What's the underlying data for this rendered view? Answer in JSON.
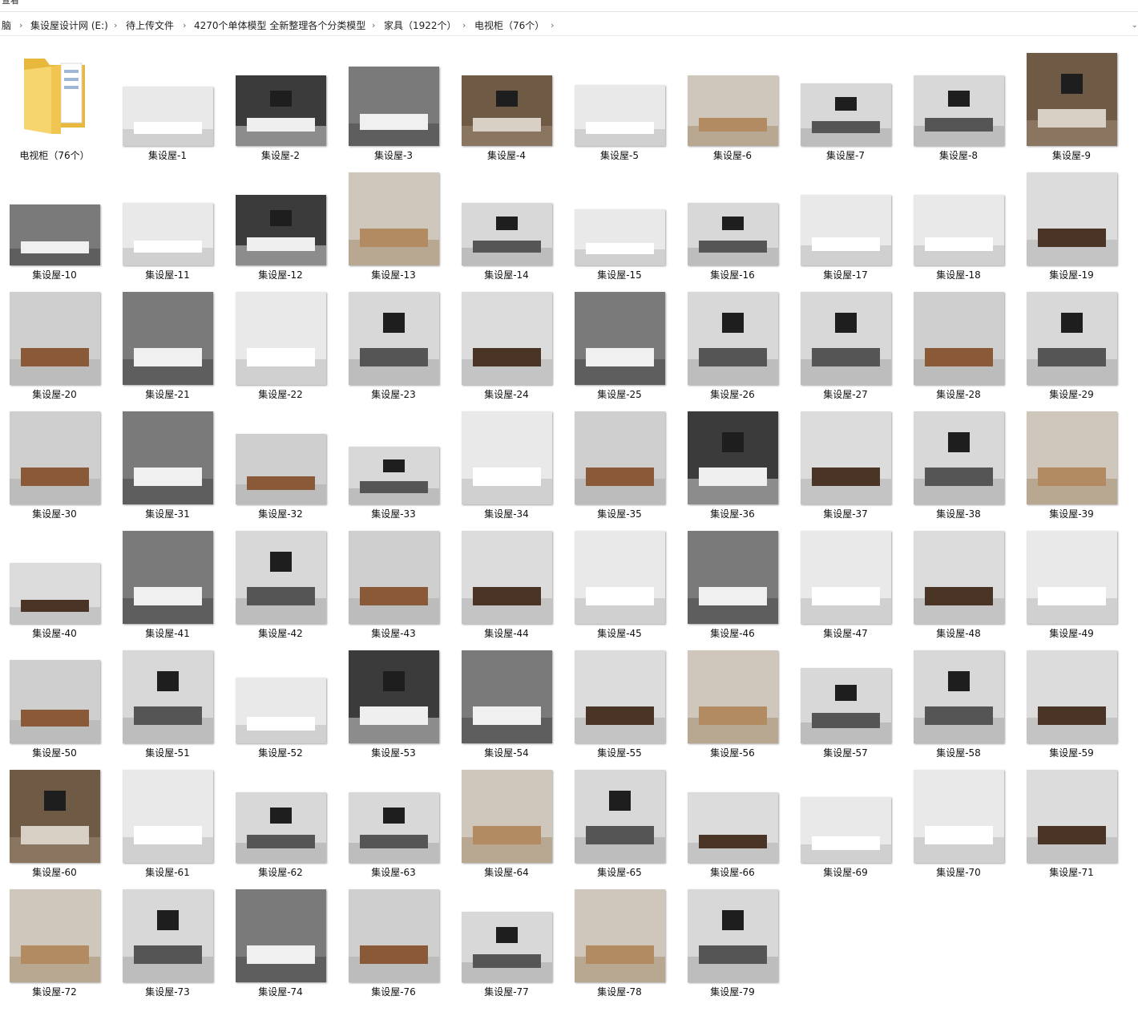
{
  "window": {
    "top_label": "查看"
  },
  "breadcrumb": {
    "items": [
      "脑",
      "集设屋设计网 (E:)",
      "待上传文件",
      "4270个单体模型 全新整理各个分类模型",
      "家具（1922个）",
      "电视柜（76个）"
    ],
    "separator": "›",
    "dropdown": "⌄"
  },
  "folder": {
    "label": "电视柜（76个）",
    "icon": "folder-icon"
  },
  "files": [
    {
      "label": "集设屋-1",
      "style": "d"
    },
    {
      "label": "集设屋-2",
      "style": "c"
    },
    {
      "label": "集设屋-3",
      "style": "b"
    },
    {
      "label": "集设屋-4",
      "style": "a"
    },
    {
      "label": "集设屋-5",
      "style": "d"
    },
    {
      "label": "集设屋-6",
      "style": "e"
    },
    {
      "label": "集设屋-7",
      "style": "f"
    },
    {
      "label": "集设屋-8",
      "style": "f"
    },
    {
      "label": "集设屋-9",
      "style": "a"
    },
    {
      "label": "集设屋-10",
      "style": "b"
    },
    {
      "label": "集设屋-11",
      "style": "d"
    },
    {
      "label": "集设屋-12",
      "style": "c"
    },
    {
      "label": "集设屋-13",
      "style": "e"
    },
    {
      "label": "集设屋-14",
      "style": "f"
    },
    {
      "label": "集设屋-15",
      "style": "d"
    },
    {
      "label": "集设屋-16",
      "style": "f"
    },
    {
      "label": "集设屋-17",
      "style": "d"
    },
    {
      "label": "集设屋-18",
      "style": "d"
    },
    {
      "label": "集设屋-19",
      "style": "g"
    },
    {
      "label": "集设屋-20",
      "style": "h"
    },
    {
      "label": "集设屋-21",
      "style": "b"
    },
    {
      "label": "集设屋-22",
      "style": "d"
    },
    {
      "label": "集设屋-23",
      "style": "f"
    },
    {
      "label": "集设屋-24",
      "style": "g"
    },
    {
      "label": "集设屋-25",
      "style": "b"
    },
    {
      "label": "集设屋-26",
      "style": "f"
    },
    {
      "label": "集设屋-27",
      "style": "f"
    },
    {
      "label": "集设屋-28",
      "style": "h"
    },
    {
      "label": "集设屋-29",
      "style": "f"
    },
    {
      "label": "集设屋-30",
      "style": "h"
    },
    {
      "label": "集设屋-31",
      "style": "b"
    },
    {
      "label": "集设屋-32",
      "style": "h"
    },
    {
      "label": "集设屋-33",
      "style": "f"
    },
    {
      "label": "集设屋-34",
      "style": "d"
    },
    {
      "label": "集设屋-35",
      "style": "h"
    },
    {
      "label": "集设屋-36",
      "style": "c"
    },
    {
      "label": "集设屋-37",
      "style": "g"
    },
    {
      "label": "集设屋-38",
      "style": "f"
    },
    {
      "label": "集设屋-39",
      "style": "e"
    },
    {
      "label": "集设屋-40",
      "style": "g"
    },
    {
      "label": "集设屋-41",
      "style": "b"
    },
    {
      "label": "集设屋-42",
      "style": "f"
    },
    {
      "label": "集设屋-43",
      "style": "h"
    },
    {
      "label": "集设屋-44",
      "style": "g"
    },
    {
      "label": "集设屋-45",
      "style": "d"
    },
    {
      "label": "集设屋-46",
      "style": "b"
    },
    {
      "label": "集设屋-47",
      "style": "d"
    },
    {
      "label": "集设屋-48",
      "style": "g"
    },
    {
      "label": "集设屋-49",
      "style": "d"
    },
    {
      "label": "集设屋-50",
      "style": "h"
    },
    {
      "label": "集设屋-51",
      "style": "f"
    },
    {
      "label": "集设屋-52",
      "style": "d"
    },
    {
      "label": "集设屋-53",
      "style": "c"
    },
    {
      "label": "集设屋-54",
      "style": "b"
    },
    {
      "label": "集设屋-55",
      "style": "g"
    },
    {
      "label": "集设屋-56",
      "style": "e"
    },
    {
      "label": "集设屋-57",
      "style": "f"
    },
    {
      "label": "集设屋-58",
      "style": "f"
    },
    {
      "label": "集设屋-59",
      "style": "g"
    },
    {
      "label": "集设屋-60",
      "style": "a"
    },
    {
      "label": "集设屋-61",
      "style": "d"
    },
    {
      "label": "集设屋-62",
      "style": "f"
    },
    {
      "label": "集设屋-63",
      "style": "f"
    },
    {
      "label": "集设屋-64",
      "style": "e"
    },
    {
      "label": "集设屋-65",
      "style": "f"
    },
    {
      "label": "集设屋-66",
      "style": "g"
    },
    {
      "label": "集设屋-69",
      "style": "d"
    },
    {
      "label": "集设屋-70",
      "style": "d"
    },
    {
      "label": "集设屋-71",
      "style": "g"
    },
    {
      "label": "集设屋-72",
      "style": "e"
    },
    {
      "label": "集设屋-73",
      "style": "f"
    },
    {
      "label": "集设屋-74",
      "style": "b"
    },
    {
      "label": "集设屋-76",
      "style": "h"
    },
    {
      "label": "集设屋-77",
      "style": "f"
    },
    {
      "label": "集设屋-78",
      "style": "e"
    },
    {
      "label": "集设屋-79",
      "style": "f"
    }
  ],
  "colors": {
    "folder_back": "#e8b83c",
    "folder_front": "#f6d46e",
    "label_text": "#111111"
  }
}
